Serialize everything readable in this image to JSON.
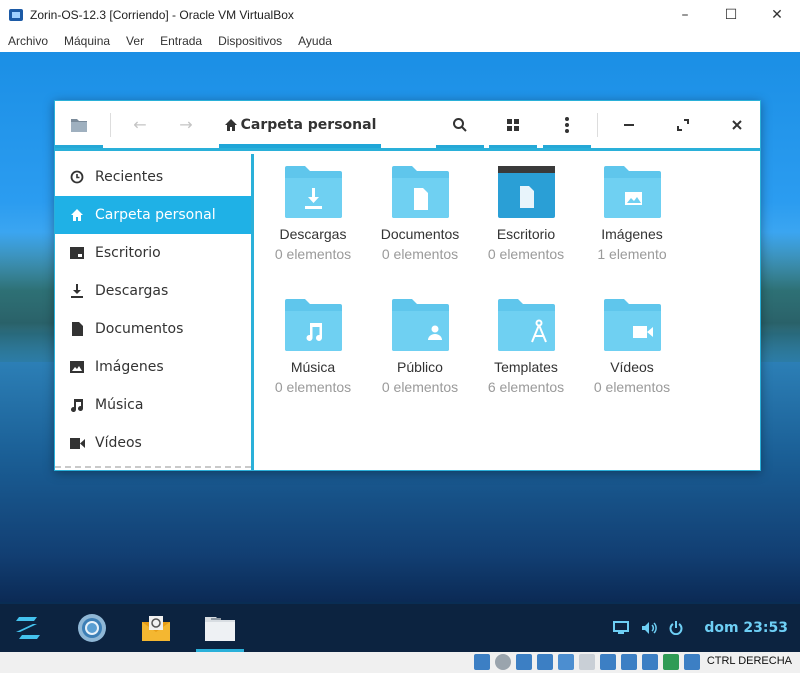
{
  "host": {
    "title": "Zorin-OS-12.3 [Corriendo] - Oracle VM VirtualBox",
    "controls": [
      "–",
      "☐",
      "✕"
    ],
    "menu": [
      "Archivo",
      "Máquina",
      "Ver",
      "Entrada",
      "Dispositivos",
      "Ayuda"
    ],
    "host_key": "CTRL DERECHA"
  },
  "file_manager": {
    "path_label": "Carpeta personal",
    "sidebar": [
      {
        "label": "Recientes",
        "icon": "clock-icon",
        "active": false
      },
      {
        "label": "Carpeta personal",
        "icon": "home-icon",
        "active": true
      },
      {
        "label": "Escritorio",
        "icon": "desktop-icon",
        "active": false
      },
      {
        "label": "Descargas",
        "icon": "download-icon",
        "active": false
      },
      {
        "label": "Documentos",
        "icon": "document-icon",
        "active": false
      },
      {
        "label": "Imágenes",
        "icon": "image-icon",
        "active": false
      },
      {
        "label": "Música",
        "icon": "music-icon",
        "active": false
      },
      {
        "label": "Vídeos",
        "icon": "video-icon",
        "active": false
      }
    ],
    "items": [
      {
        "name": "Descargas",
        "count": "0 elementos",
        "icon": "download"
      },
      {
        "name": "Documentos",
        "count": "0 elementos",
        "icon": "document"
      },
      {
        "name": "Escritorio",
        "count": "0 elementos",
        "icon": "desktop"
      },
      {
        "name": "Imágenes",
        "count": "1 elemento",
        "icon": "image"
      },
      {
        "name": "Música",
        "count": "0 elementos",
        "icon": "music"
      },
      {
        "name": "Público",
        "count": "0 elementos",
        "icon": "public"
      },
      {
        "name": "Templates",
        "count": "6 elementos",
        "icon": "templates"
      },
      {
        "name": "Vídeos",
        "count": "0 elementos",
        "icon": "video"
      }
    ]
  },
  "taskbar": {
    "clock": "dom 23:53",
    "apps": [
      "zorin-menu-icon",
      "chromium-icon",
      "mail-icon",
      "files-icon"
    ]
  },
  "colors": {
    "accent": "#2ab0d9",
    "folder": "#5fc6ec",
    "folder_dark": "#2a9fd6",
    "taskbar": "#0c2340",
    "active_item": "#1fb1e6"
  }
}
